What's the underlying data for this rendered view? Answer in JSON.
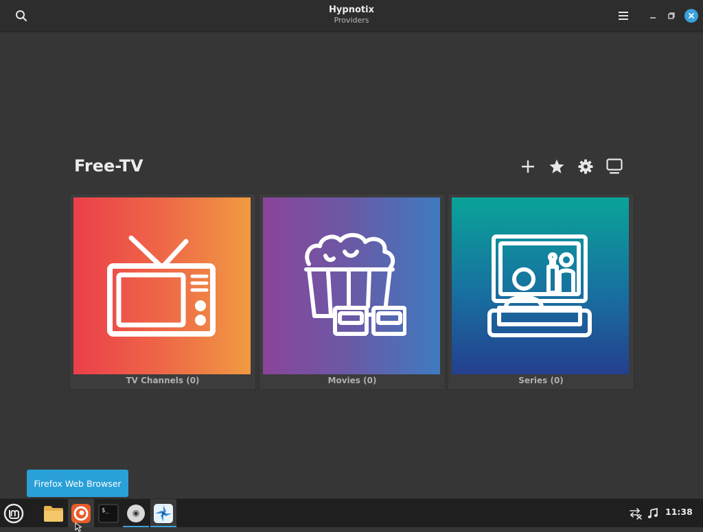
{
  "window": {
    "title": "Hypnotix",
    "subtitle": "Providers"
  },
  "provider": {
    "name": "Free-TV"
  },
  "toolbar": [
    {
      "name": "add-provider-button",
      "icon": "plus-icon"
    },
    {
      "name": "favorites-button",
      "icon": "star-icon"
    },
    {
      "name": "preferences-button",
      "icon": "gear-icon"
    },
    {
      "name": "fullscreen-button",
      "icon": "monitor-icon"
    }
  ],
  "categories": [
    {
      "label": "TV Channels (0)",
      "icon": "television-icon",
      "colors": [
        "#ec3e4a",
        "#f09a42"
      ]
    },
    {
      "label": "Movies (0)",
      "icon": "popcorn-3d-glasses-icon",
      "colors": [
        "#8a449a",
        "#3e7bc0"
      ]
    },
    {
      "label": "Series (0)",
      "icon": "person-watching-tv-icon",
      "colors": [
        "#0aa399",
        "#243f8e"
      ]
    }
  ],
  "tooltip": {
    "text": "Firefox Web Browser"
  },
  "taskbar": {
    "apps": [
      {
        "name": "menu",
        "icon": "linux-mint-menu-icon"
      },
      {
        "name": "files",
        "icon": "folder-icon"
      },
      {
        "name": "firefox",
        "icon": "firefox-icon"
      },
      {
        "name": "terminal",
        "icon": "terminal-icon"
      },
      {
        "name": "disc",
        "icon": "disc-icon"
      },
      {
        "name": "hypnotix",
        "icon": "hypnotix-icon"
      }
    ],
    "tray": {
      "network_icon": "network-offline-icon",
      "sound_icon": "music-note-icon",
      "clock": "11:38"
    }
  },
  "accent": "#3aa1dd"
}
